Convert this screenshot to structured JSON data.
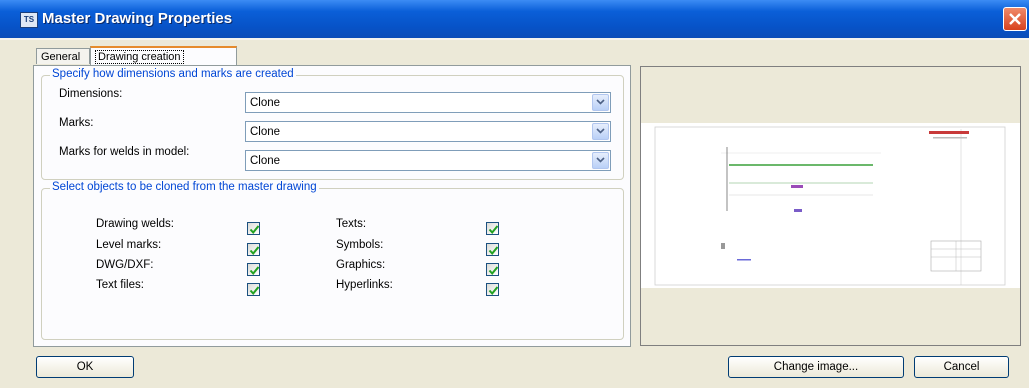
{
  "window": {
    "title": "Master Drawing Properties"
  },
  "tabs": [
    {
      "label": "General",
      "active": false
    },
    {
      "label": "Drawing creation",
      "active": true
    }
  ],
  "group_dims": {
    "title": "Specify how dimensions and marks are created",
    "fields": [
      {
        "label": "Dimensions:",
        "value": "Clone"
      },
      {
        "label": "Marks:",
        "value": "Clone"
      },
      {
        "label": "Marks for welds in model:",
        "value": "Clone"
      }
    ]
  },
  "group_clone": {
    "title": "Select objects to be cloned from the master drawing",
    "left": [
      {
        "label": "Drawing welds:",
        "checked": true
      },
      {
        "label": "Level marks:",
        "checked": true
      },
      {
        "label": "DWG/DXF:",
        "checked": true
      },
      {
        "label": "Text files:",
        "checked": true
      }
    ],
    "right": [
      {
        "label": "Texts:",
        "checked": true
      },
      {
        "label": "Symbols:",
        "checked": true
      },
      {
        "label": "Graphics:",
        "checked": true
      },
      {
        "label": "Hyperlinks:",
        "checked": true
      }
    ]
  },
  "buttons": {
    "ok": "OK",
    "change_image": "Change image...",
    "cancel": "Cancel"
  },
  "colors": {
    "title_bar": "#0a5fd8",
    "group_title": "#0046d5",
    "check": "#21a121",
    "dialog_bg": "#ece9d8"
  }
}
